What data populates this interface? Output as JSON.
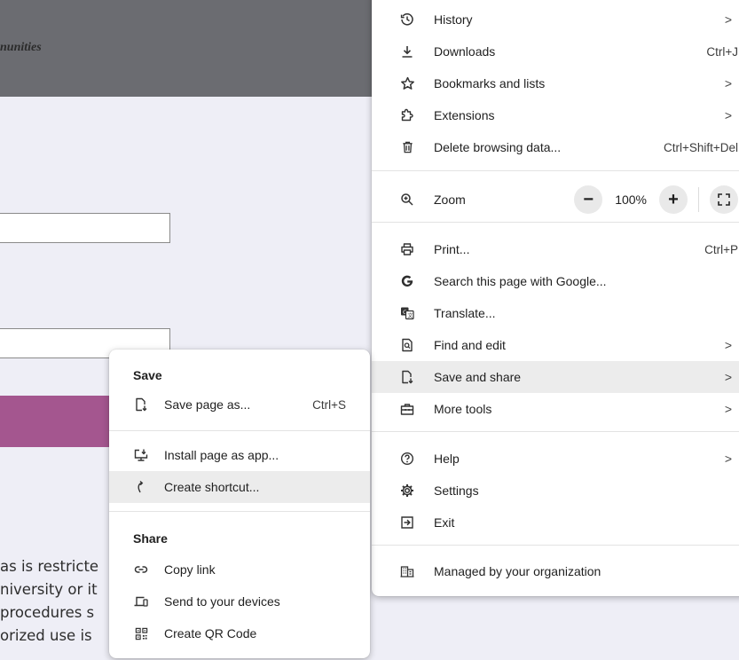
{
  "background": {
    "header_title_fragment": "nunities",
    "text_lines": [
      "as is restricte",
      "niversity or it",
      "procedures s",
      "orized use is"
    ]
  },
  "main_menu": {
    "items_top": [
      {
        "label": "History",
        "shortcut": "",
        "chevron": ">",
        "icon": "history-icon"
      },
      {
        "label": "Downloads",
        "shortcut": "Ctrl+J",
        "chevron": "",
        "icon": "download-icon"
      },
      {
        "label": "Bookmarks and lists",
        "shortcut": "",
        "chevron": ">",
        "icon": "star-icon"
      },
      {
        "label": "Extensions",
        "shortcut": "",
        "chevron": ">",
        "icon": "puzzle-icon"
      },
      {
        "label": "Delete browsing data...",
        "shortcut": "Ctrl+Shift+Del",
        "chevron": "",
        "icon": "trash-icon"
      }
    ],
    "zoom": {
      "label": "Zoom",
      "minus": "−",
      "value": "100%",
      "plus": "+",
      "icon": "zoom-icon",
      "fullscreen_icon": "fullscreen-icon"
    },
    "items_mid": [
      {
        "label": "Print...",
        "shortcut": "Ctrl+P",
        "chevron": "",
        "icon": "print-icon"
      },
      {
        "label": "Search this page with Google...",
        "shortcut": "",
        "chevron": "",
        "icon": "google-icon"
      },
      {
        "label": "Translate...",
        "shortcut": "",
        "chevron": "",
        "icon": "translate-icon"
      },
      {
        "label": "Find and edit",
        "shortcut": "",
        "chevron": ">",
        "icon": "find-icon"
      },
      {
        "label": "Save and share",
        "shortcut": "",
        "chevron": ">",
        "icon": "save-share-icon"
      },
      {
        "label": "More tools",
        "shortcut": "",
        "chevron": ">",
        "icon": "toolbox-icon"
      }
    ],
    "items_bottom": [
      {
        "label": "Help",
        "shortcut": "",
        "chevron": ">",
        "icon": "help-icon"
      },
      {
        "label": "Settings",
        "shortcut": "",
        "chevron": "",
        "icon": "gear-icon"
      },
      {
        "label": "Exit",
        "shortcut": "",
        "chevron": "",
        "icon": "exit-icon"
      }
    ],
    "managed": {
      "label": "Managed by your organization",
      "icon": "building-icon"
    }
  },
  "sub_menu": {
    "save_title": "Save",
    "save_page": {
      "label": "Save page as...",
      "shortcut": "Ctrl+S"
    },
    "install_app": {
      "label": "Install page as app..."
    },
    "create_shortcut": {
      "label": "Create shortcut..."
    },
    "share_title": "Share",
    "copy_link": {
      "label": "Copy link"
    },
    "send_devices": {
      "label": "Send to your devices"
    },
    "qr_code": {
      "label": "Create QR Code"
    }
  }
}
